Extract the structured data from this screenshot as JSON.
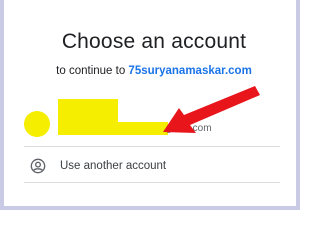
{
  "dialog": {
    "title": "Choose an account",
    "subtitle_prefix": "to continue to ",
    "site": "75suryanamaskar.com"
  },
  "account": {
    "email_visible_suffix": "gmail.com",
    "redaction_color": "#f5ee00"
  },
  "other_account": {
    "label": "Use another account",
    "icon": "account-circle-icon"
  },
  "annotation": {
    "arrow_color": "#e8151b"
  },
  "colors": {
    "link": "#1a73e8",
    "frame": "#c9cbe6",
    "divider": "#dadce0"
  }
}
